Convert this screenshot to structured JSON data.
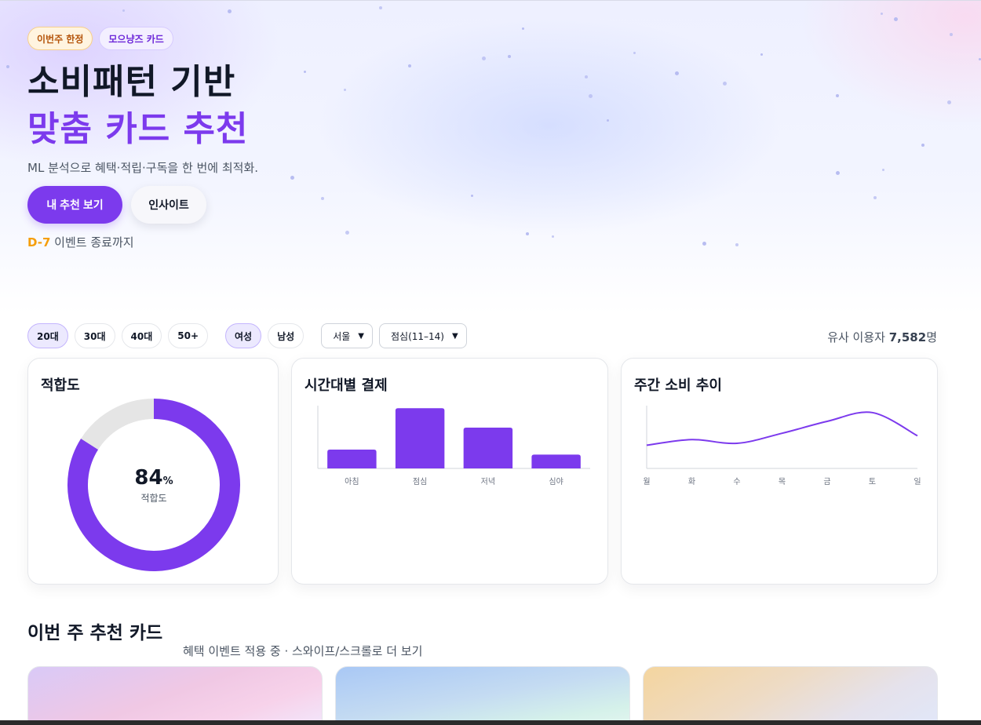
{
  "hero": {
    "badges": [
      "이번주 한정",
      "모으냥즈 카드"
    ],
    "title_line1": "소비패턴 기반",
    "title_line2": "맞춤 카드 추천",
    "subtitle": "ML 분석으로 혜택·적립·구독을 한 번에 최적화.",
    "primary_button": "내 추천 보기",
    "secondary_button": "인사이트",
    "countdown_badge": "D-7",
    "countdown_text": " 이벤트 종료까지"
  },
  "filters": {
    "age_chips": [
      {
        "label": "20대",
        "active": true
      },
      {
        "label": "30대",
        "active": false
      },
      {
        "label": "40대",
        "active": false
      },
      {
        "label": "50+",
        "active": false
      }
    ],
    "gender_chips": [
      {
        "label": "여성",
        "active": true
      },
      {
        "label": "남성",
        "active": false
      }
    ],
    "region_select": "서울",
    "time_select": "점심(11–14)",
    "similar_users_prefix": "유사 이용자 ",
    "similar_users_count": "7,582",
    "similar_users_suffix": "명"
  },
  "cards": {
    "fit_title": "적합도",
    "time_title": "시간대별 결제",
    "week_title": "주간 소비 추이"
  },
  "chart_data": [
    {
      "type": "pie",
      "title": "적합도",
      "values": [
        84,
        16
      ],
      "center_value": "84",
      "center_unit": "%",
      "center_label": "적합도",
      "colors": [
        "#7c3aed",
        "#e5e5e5"
      ]
    },
    {
      "type": "bar",
      "title": "시간대별 결제",
      "categories": [
        "아침",
        "점심",
        "저녁",
        "심야"
      ],
      "values": [
        30,
        96,
        65,
        22
      ],
      "ylim": [
        0,
        100
      ],
      "color": "#7c3aed"
    },
    {
      "type": "line",
      "title": "주간 소비 추이",
      "categories": [
        "월",
        "화",
        "수",
        "목",
        "금",
        "토",
        "일"
      ],
      "values": [
        37,
        46,
        40,
        56,
        75,
        89,
        52
      ],
      "ylim": [
        0,
        100
      ],
      "color": "#7c3aed"
    }
  ],
  "recommend": {
    "title": "이번 주 추천 카드",
    "subtitle": "혜택 이벤트 적용 중 · 스와이프/스크롤로 더 보기"
  }
}
